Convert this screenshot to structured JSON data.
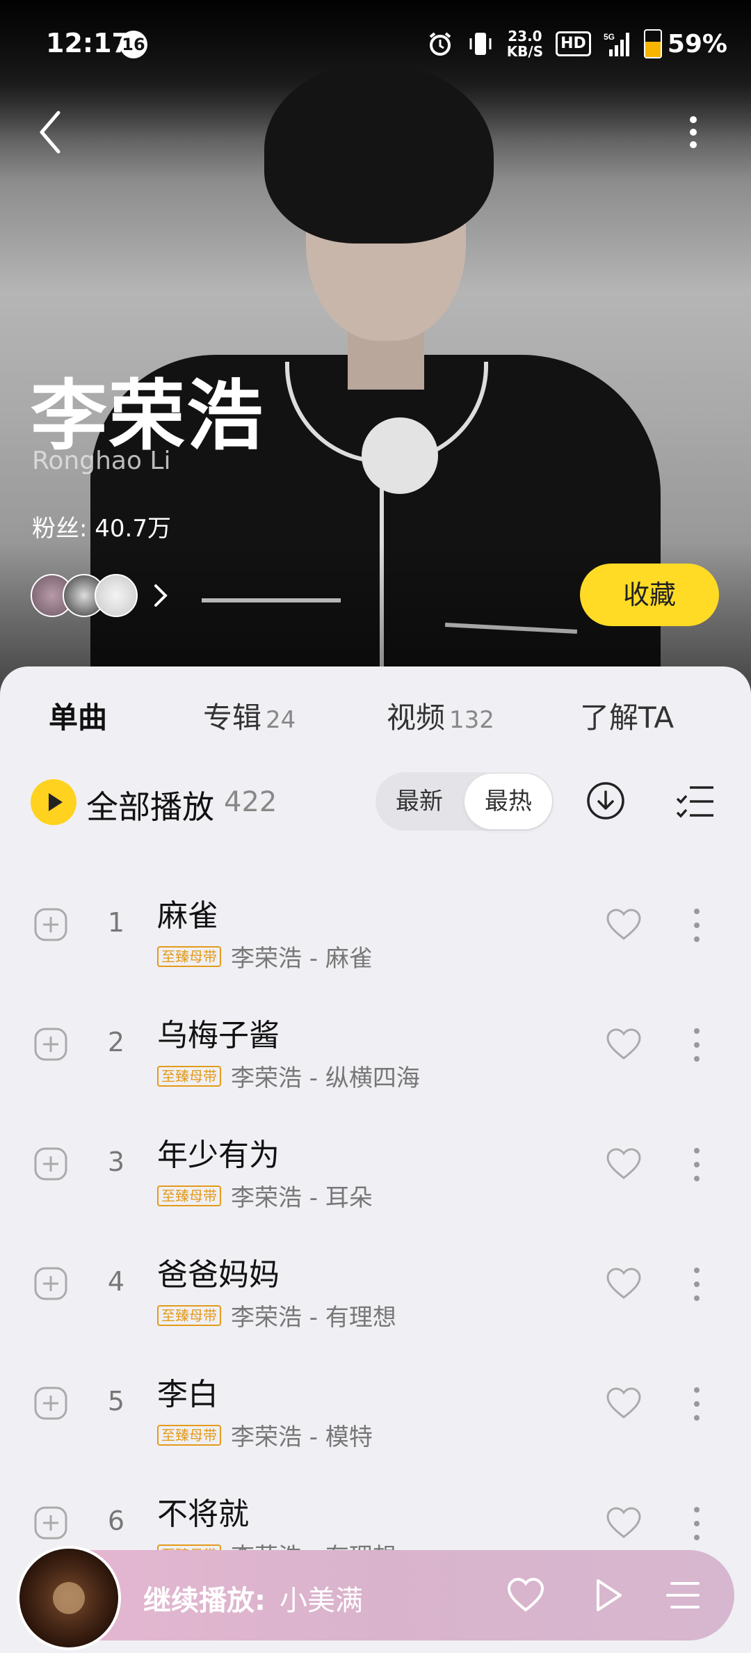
{
  "status_bar": {
    "time": "12:17",
    "notification_count": "16",
    "net_speed_value": "23.0",
    "net_speed_unit": "KB/S",
    "hd_label": "HD",
    "signal_label": "5G",
    "battery_percent": "59%",
    "battery_level": 0.59
  },
  "artist": {
    "name": "李荣浩",
    "name_en": "Ronghao Li",
    "fans": "粉丝: 40.7万",
    "collect_label": "收藏"
  },
  "tabs": [
    {
      "label": "单曲",
      "count": ""
    },
    {
      "label": "专辑",
      "count": "24"
    },
    {
      "label": "视频",
      "count": "132"
    },
    {
      "label": "了解TA",
      "count": ""
    }
  ],
  "play_all": {
    "label": "全部播放",
    "count": "422"
  },
  "sort": {
    "newest": "最新",
    "hottest": "最热",
    "selected": "最热"
  },
  "songs": [
    {
      "num": "1",
      "title": "麻雀",
      "tag": "至臻母带",
      "meta": "李荣浩 - 麻雀"
    },
    {
      "num": "2",
      "title": "乌梅子酱",
      "tag": "至臻母带",
      "meta": "李荣浩 - 纵横四海"
    },
    {
      "num": "3",
      "title": "年少有为",
      "tag": "至臻母带",
      "meta": "李荣浩 - 耳朵"
    },
    {
      "num": "4",
      "title": "爸爸妈妈",
      "tag": "至臻母带",
      "meta": "李荣浩 - 有理想"
    },
    {
      "num": "5",
      "title": "李白",
      "tag": "至臻母带",
      "meta": "李荣浩 - 模特"
    },
    {
      "num": "6",
      "title": "不将就",
      "tag": "至臻母带",
      "meta": "李荣浩 - 有理想"
    }
  ],
  "mini_player": {
    "label": "继续播放:",
    "song": "小美满"
  },
  "colors": {
    "accent": "#ffdb26",
    "tag": "#e39a1b"
  }
}
